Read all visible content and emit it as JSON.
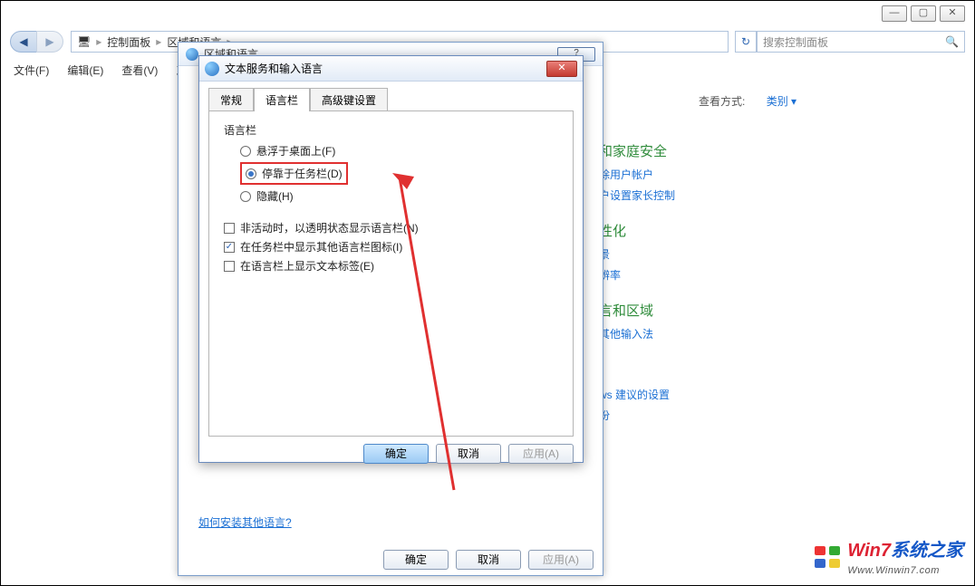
{
  "window_controls": {
    "min": "—",
    "max": "▢",
    "close": "✕"
  },
  "nav": {
    "back": "◀",
    "fwd": "▶",
    "path_icon": "▸",
    "path_1": "控制面板",
    "path_2": "区域和语言",
    "refresh": "↻",
    "search_placeholder": "搜索控制面板",
    "search_icon": "🔍"
  },
  "menu": {
    "file": "文件(F)",
    "edit": "编辑(E)",
    "view": "查看(V)",
    "tools": "工"
  },
  "bg": {
    "view_label": "查看方式:",
    "category": "类别 ▾",
    "sec_title": "和家庭安全",
    "sec_l1": "除用户帐户",
    "sec_l2": "户设置家长控制",
    "pers_title": "性化",
    "pers_l1": "景",
    "pers_l2": "辨率",
    "lang_title": "言和区域",
    "lang_l1": "其他输入法",
    "rec_l1": "ws 建议的设置",
    "rec_l2": "份"
  },
  "outer": {
    "title": "区域和语言",
    "help_link": "如何安装其他语言?",
    "ok": "确定",
    "cancel": "取消",
    "apply": "应用(A)"
  },
  "inner": {
    "title": "文本服务和输入语言",
    "close": "✕",
    "tabs": {
      "general": "常规",
      "langbar": "语言栏",
      "adv": "高级键设置"
    },
    "group": "语言栏",
    "opt_float": "悬浮于桌面上(F)",
    "opt_dock": "停靠于任务栏(D)",
    "opt_hide": "隐藏(H)",
    "chk_transp": "非活动时，以透明状态显示语言栏(N)",
    "chk_icons": "在任务栏中显示其他语言栏图标(I)",
    "chk_labels": "在语言栏上显示文本标签(E)",
    "ok": "确定",
    "cancel": "取消",
    "apply": "应用(A)"
  },
  "watermark": {
    "brand1": "Win7",
    "brand2": "系统之家",
    "url": "Www.Winwin7.com"
  }
}
